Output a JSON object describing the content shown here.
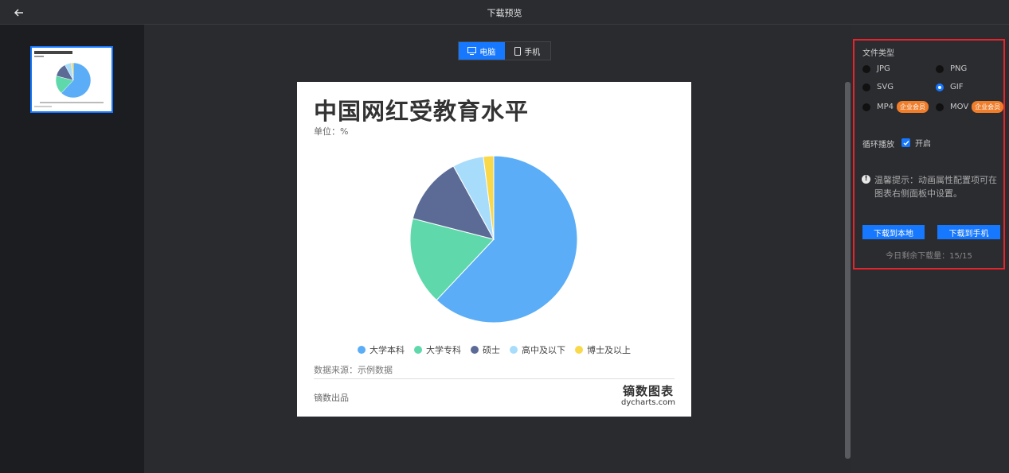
{
  "header": {
    "title": "下载预览"
  },
  "view_toggle": {
    "desktop_label": "电脑",
    "mobile_label": "手机",
    "active": "desktop"
  },
  "chart_card": {
    "title": "中国网红受教育水平",
    "unit": "单位：%",
    "source": "数据来源：示例数据",
    "footer": "镝数出品",
    "logo_cn": "镝数图表",
    "logo_en": "dycharts.com"
  },
  "chart_data": {
    "type": "pie",
    "title": "中国网红受教育水平",
    "unit": "%",
    "categories": [
      "大学本科",
      "大学专科",
      "硕士",
      "高中及以下",
      "博士及以上"
    ],
    "values": [
      62,
      17,
      13,
      6,
      2
    ],
    "colors": [
      "#5aadf6",
      "#5fd8ab",
      "#5b6b96",
      "#a8dcfb",
      "#f9d84a"
    ],
    "legend_position": "bottom"
  },
  "settings": {
    "file_type_label": "文件类型",
    "options": [
      {
        "label": "JPG",
        "selected": false,
        "badge": ""
      },
      {
        "label": "PNG",
        "selected": false,
        "badge": ""
      },
      {
        "label": "SVG",
        "selected": false,
        "badge": ""
      },
      {
        "label": "GIF",
        "selected": true,
        "badge": ""
      },
      {
        "label": "MP4",
        "selected": false,
        "badge": "企业会员"
      },
      {
        "label": "MOV",
        "selected": false,
        "badge": "企业会员"
      }
    ],
    "loop_label": "循环播放",
    "loop_option": "开启",
    "tip": "温馨提示：动画属性配置项可在图表右侧面板中设置。",
    "download_local": "下载到本地",
    "download_mobile": "下载到手机",
    "remaining": "今日剩余下载量：15/15"
  },
  "colors": {
    "accent": "#1677ff",
    "highlight_border": "#e8232b",
    "badge": "#ef7d2a"
  }
}
